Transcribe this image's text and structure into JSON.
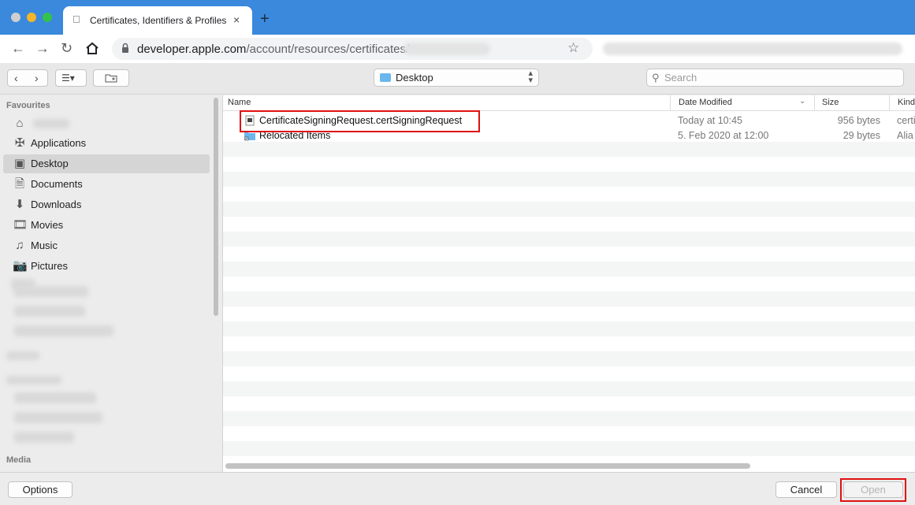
{
  "browser": {
    "tab_title": "Certificates, Identifiers & Profiles",
    "new_tab_label": "+",
    "tab_close_label": "×",
    "url_host": "developer.apple.com",
    "url_path": "/account/resources/certificates/"
  },
  "toolbar": {
    "location": "Desktop",
    "search_placeholder": "Search"
  },
  "sidebar": {
    "favourites_heading": "Favourites",
    "items": [
      {
        "label": "",
        "icon": "home-icon",
        "blurred": true
      },
      {
        "label": "Applications",
        "icon": "applications-icon"
      },
      {
        "label": "Desktop",
        "icon": "desktop-icon",
        "selected": true
      },
      {
        "label": "Documents",
        "icon": "documents-icon"
      },
      {
        "label": "Downloads",
        "icon": "downloads-icon"
      },
      {
        "label": "Movies",
        "icon": "movies-icon"
      },
      {
        "label": "Music",
        "icon": "music-icon"
      },
      {
        "label": "Pictures",
        "icon": "pictures-icon"
      }
    ],
    "media_heading": "Media"
  },
  "filelist": {
    "columns": {
      "name": "Name",
      "date": "Date Modified",
      "size": "Size",
      "kind": "Kind"
    },
    "files": [
      {
        "name": "CertificateSigningRequest.certSigningRequest",
        "date": "Today at 10:45",
        "size": "956 bytes",
        "kind": "certi",
        "icon": "document-icon"
      },
      {
        "name": "Relocated Items",
        "date": "5. Feb 2020 at 12:00",
        "size": "29 bytes",
        "kind": "Alia",
        "icon": "alias-folder-icon"
      }
    ]
  },
  "bottom": {
    "options_label": "Options",
    "cancel_label": "Cancel",
    "open_label": "Open"
  },
  "colors": {
    "highlight": "#e01010",
    "tabstrip": "#3a89dc"
  }
}
